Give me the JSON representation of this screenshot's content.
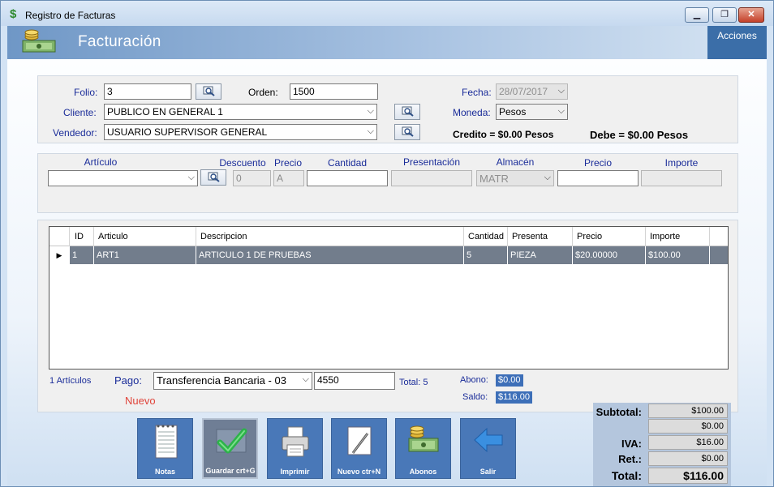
{
  "window": {
    "title": "Registro de Facturas",
    "minimize": "▁",
    "maximize": "❐",
    "close": "✕"
  },
  "header": {
    "title": "Facturación",
    "acciones": "Acciones"
  },
  "form": {
    "folio_label": "Folio:",
    "folio_value": "3",
    "orden_label": "Orden:",
    "orden_value": "1500",
    "cliente_label": "Cliente:",
    "cliente_value": "PUBLICO EN GENERAL 1",
    "vendedor_label": "Vendedor:",
    "vendedor_value": "USUARIO SUPERVISOR GENERAL",
    "fecha_label": "Fecha:",
    "fecha_value": "28/07/2017",
    "moneda_label": "Moneda:",
    "moneda_value": "Pesos",
    "credito": "Credito = $0.00 Pesos",
    "debe": "Debe = $0.00 Pesos"
  },
  "entry": {
    "articulo_label": "Artículo",
    "articulo_value": "",
    "descuento_label": "Descuento",
    "descuento_value": "0",
    "precio_label": "Precio",
    "precio_value": "A",
    "cantidad_label": "Cantidad",
    "cantidad_value": "",
    "presentacion_label": "Presentación",
    "presentacion_value": "",
    "almacen_label": "Almacén",
    "almacen_value": "MATR",
    "precio2_label": "Precio",
    "precio2_value": "",
    "importe_label": "Importe",
    "importe_value": ""
  },
  "grid": {
    "columns": [
      "ID",
      "Articulo",
      "Descripcion",
      "Cantidad",
      "Presenta",
      "Precio",
      "Importe"
    ],
    "rows": [
      {
        "marker": "▶",
        "id": "1",
        "articulo": "ART1",
        "descripcion": "ARTICULO 1 DE PRUEBAS",
        "cantidad": "5",
        "presenta": "PIEZA",
        "precio": "$20.00000",
        "importe": "$100.00"
      }
    ]
  },
  "footer": {
    "articulos_count": "1 Artículos",
    "pago_label": "Pago:",
    "pago_value": "Transferencia Bancaria - 03",
    "pago_ref": "4550",
    "total_count": "Total: 5",
    "nuevo": "Nuevo",
    "abono_label": "Abono:",
    "abono_value": "$0.00",
    "saldo_label": "Saldo:",
    "saldo_value": "$116.00"
  },
  "totals": {
    "subtotal_label": "Subtotal:",
    "subtotal_value": "$100.00",
    "descuento_value": "$0.00",
    "iva_label": "IVA:",
    "iva_value": "$16.00",
    "ret_label": "Ret.:",
    "ret_value": "$0.00",
    "total_label": "Total:",
    "total_value": "$116.00"
  },
  "toolbar": [
    {
      "label": "Notas",
      "icon": "notepad-icon"
    },
    {
      "label": "Guardar crt+G",
      "icon": "checkmark-icon"
    },
    {
      "label": "Imprimir",
      "icon": "printer-icon"
    },
    {
      "label": "Nuevo ctr+N",
      "icon": "new-document-icon"
    },
    {
      "label": "Abonos",
      "icon": "money-icon"
    },
    {
      "label": "Salir",
      "icon": "back-arrow-icon"
    }
  ],
  "colors": {
    "header_accent": "#3b6ea8",
    "button_blue": "#4978b8",
    "selected_row": "#727d8c",
    "label_blue": "#1a2c99",
    "nuevo_red": "#e0443a"
  }
}
